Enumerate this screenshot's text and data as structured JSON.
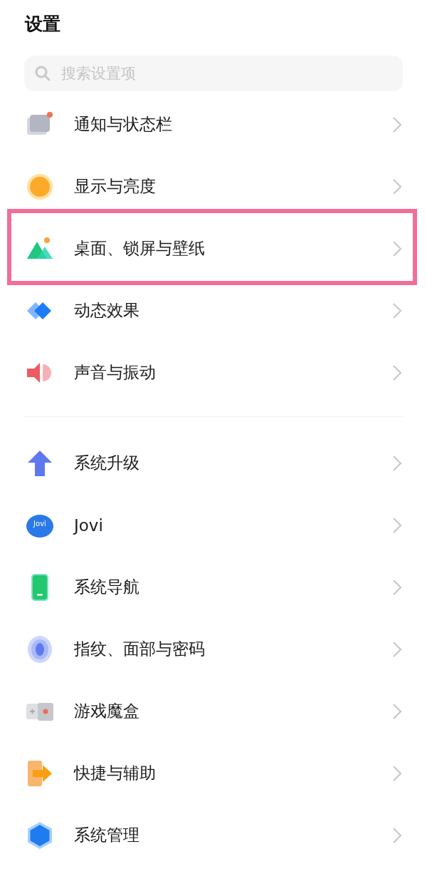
{
  "title": "设置",
  "search": {
    "placeholder": "搜索设置项"
  },
  "groups": [
    {
      "items": [
        {
          "label": "通知与状态栏",
          "kind": "notification",
          "highlighted": false
        },
        {
          "label": "显示与亮度",
          "kind": "sun",
          "highlighted": false
        },
        {
          "label": "桌面、锁屏与壁纸",
          "kind": "mountain",
          "highlighted": true
        },
        {
          "label": "动态效果",
          "kind": "diamond",
          "highlighted": false
        },
        {
          "label": "声音与振动",
          "kind": "speaker",
          "highlighted": false
        }
      ]
    },
    {
      "items": [
        {
          "label": "系统升级",
          "kind": "arrow",
          "highlighted": false
        },
        {
          "label": "Jovi",
          "kind": "jovi",
          "icon_text": "Jovi",
          "highlighted": false
        },
        {
          "label": "系统导航",
          "kind": "phone",
          "highlighted": false
        },
        {
          "label": "指纹、面部与密码",
          "kind": "fingerprint",
          "highlighted": false
        },
        {
          "label": "游戏魔盒",
          "kind": "game",
          "highlighted": false
        },
        {
          "label": "快捷与辅助",
          "kind": "shortcut",
          "highlighted": false
        },
        {
          "label": "系统管理",
          "kind": "hexagon",
          "highlighted": false
        }
      ]
    }
  ]
}
